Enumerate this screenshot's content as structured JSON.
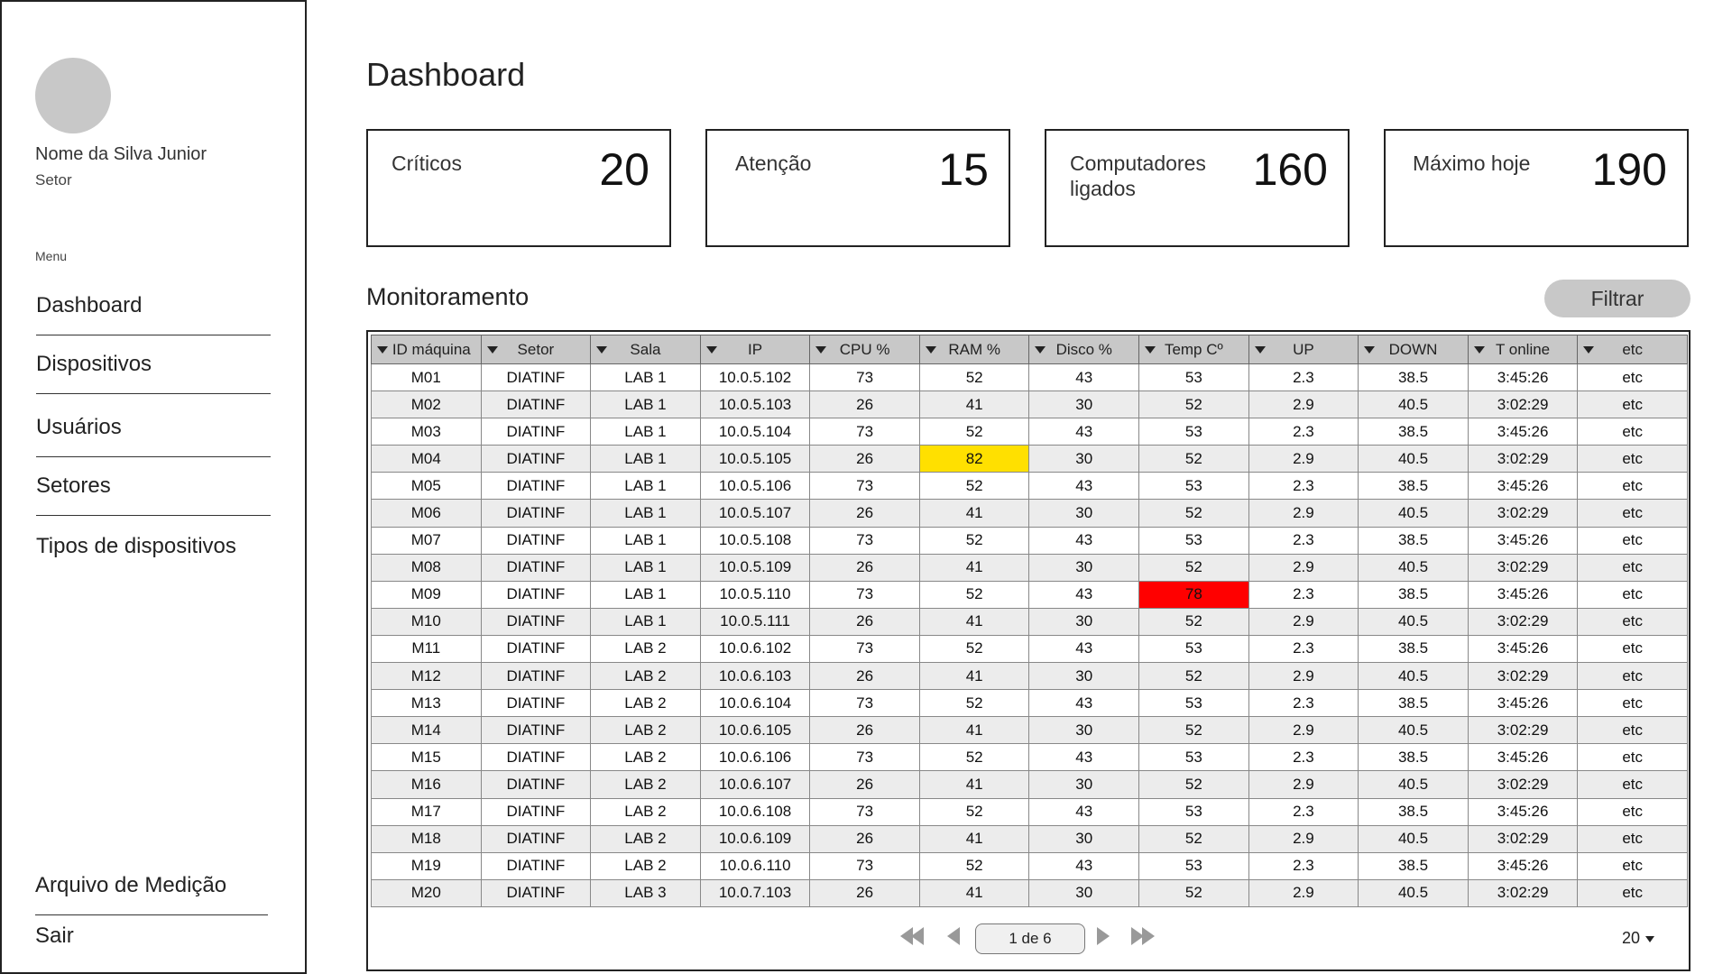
{
  "user": {
    "name": "Nome da Silva Junior",
    "sector": "Setor"
  },
  "menu": {
    "label": "Menu",
    "items": [
      "Dashboard",
      "Dispositivos",
      "Usuários",
      "Setores",
      "Tipos de dispositivos"
    ],
    "file": "Arquivo de Medição",
    "logout": "Sair"
  },
  "page": {
    "title": "Dashboard"
  },
  "stats": [
    {
      "label": "Críticos",
      "value": "20"
    },
    {
      "label": "Atenção",
      "value": "15"
    },
    {
      "label": "Computadores ligados",
      "value": "160"
    },
    {
      "label": "Máximo hoje",
      "value": "190"
    }
  ],
  "monitor": {
    "title": "Monitoramento",
    "filter_label": "Filtrar"
  },
  "table": {
    "columns": [
      "ID máquina",
      "Setor",
      "Sala",
      "IP",
      "CPU %",
      "RAM %",
      "Disco %",
      "Temp Cº",
      "UP",
      "DOWN",
      "T online",
      "etc"
    ],
    "rows": [
      [
        "M01",
        "DIATINF",
        "LAB 1",
        "10.0.5.102",
        "73",
        "52",
        "43",
        "53",
        "2.3",
        "38.5",
        "3:45:26",
        "etc"
      ],
      [
        "M02",
        "DIATINF",
        "LAB 1",
        "10.0.5.103",
        "26",
        "41",
        "30",
        "52",
        "2.9",
        "40.5",
        "3:02:29",
        "etc"
      ],
      [
        "M03",
        "DIATINF",
        "LAB 1",
        "10.0.5.104",
        "73",
        "52",
        "43",
        "53",
        "2.3",
        "38.5",
        "3:45:26",
        "etc"
      ],
      [
        "M04",
        "DIATINF",
        "LAB 1",
        "10.0.5.105",
        "26",
        "82",
        "30",
        "52",
        "2.9",
        "40.5",
        "3:02:29",
        "etc"
      ],
      [
        "M05",
        "DIATINF",
        "LAB 1",
        "10.0.5.106",
        "73",
        "52",
        "43",
        "53",
        "2.3",
        "38.5",
        "3:45:26",
        "etc"
      ],
      [
        "M06",
        "DIATINF",
        "LAB 1",
        "10.0.5.107",
        "26",
        "41",
        "30",
        "52",
        "2.9",
        "40.5",
        "3:02:29",
        "etc"
      ],
      [
        "M07",
        "DIATINF",
        "LAB 1",
        "10.0.5.108",
        "73",
        "52",
        "43",
        "53",
        "2.3",
        "38.5",
        "3:45:26",
        "etc"
      ],
      [
        "M08",
        "DIATINF",
        "LAB 1",
        "10.0.5.109",
        "26",
        "41",
        "30",
        "52",
        "2.9",
        "40.5",
        "3:02:29",
        "etc"
      ],
      [
        "M09",
        "DIATINF",
        "LAB 1",
        "10.0.5.110",
        "73",
        "52",
        "43",
        "78",
        "2.3",
        "38.5",
        "3:45:26",
        "etc"
      ],
      [
        "M10",
        "DIATINF",
        "LAB 1",
        "10.0.5.111",
        "26",
        "41",
        "30",
        "52",
        "2.9",
        "40.5",
        "3:02:29",
        "etc"
      ],
      [
        "M11",
        "DIATINF",
        "LAB 2",
        "10.0.6.102",
        "73",
        "52",
        "43",
        "53",
        "2.3",
        "38.5",
        "3:45:26",
        "etc"
      ],
      [
        "M12",
        "DIATINF",
        "LAB 2",
        "10.0.6.103",
        "26",
        "41",
        "30",
        "52",
        "2.9",
        "40.5",
        "3:02:29",
        "etc"
      ],
      [
        "M13",
        "DIATINF",
        "LAB 2",
        "10.0.6.104",
        "73",
        "52",
        "43",
        "53",
        "2.3",
        "38.5",
        "3:45:26",
        "etc"
      ],
      [
        "M14",
        "DIATINF",
        "LAB 2",
        "10.0.6.105",
        "26",
        "41",
        "30",
        "52",
        "2.9",
        "40.5",
        "3:02:29",
        "etc"
      ],
      [
        "M15",
        "DIATINF",
        "LAB 2",
        "10.0.6.106",
        "73",
        "52",
        "43",
        "53",
        "2.3",
        "38.5",
        "3:45:26",
        "etc"
      ],
      [
        "M16",
        "DIATINF",
        "LAB 2",
        "10.0.6.107",
        "26",
        "41",
        "30",
        "52",
        "2.9",
        "40.5",
        "3:02:29",
        "etc"
      ],
      [
        "M17",
        "DIATINF",
        "LAB 2",
        "10.0.6.108",
        "73",
        "52",
        "43",
        "53",
        "2.3",
        "38.5",
        "3:45:26",
        "etc"
      ],
      [
        "M18",
        "DIATINF",
        "LAB 2",
        "10.0.6.109",
        "26",
        "41",
        "30",
        "52",
        "2.9",
        "40.5",
        "3:02:29",
        "etc"
      ],
      [
        "M19",
        "DIATINF",
        "LAB 2",
        "10.0.6.110",
        "73",
        "52",
        "43",
        "53",
        "2.3",
        "38.5",
        "3:45:26",
        "etc"
      ],
      [
        "M20",
        "DIATINF",
        "LAB 3",
        "10.0.7.103",
        "26",
        "41",
        "30",
        "52",
        "2.9",
        "40.5",
        "3:02:29",
        "etc"
      ]
    ],
    "highlights": [
      {
        "row": 3,
        "col": 5,
        "level": "warn",
        "color": "#ffe000"
      },
      {
        "row": 8,
        "col": 7,
        "level": "crit",
        "color": "#ff0000"
      }
    ]
  },
  "pagination": {
    "page_label": "1 de 6",
    "page_size": "20"
  }
}
